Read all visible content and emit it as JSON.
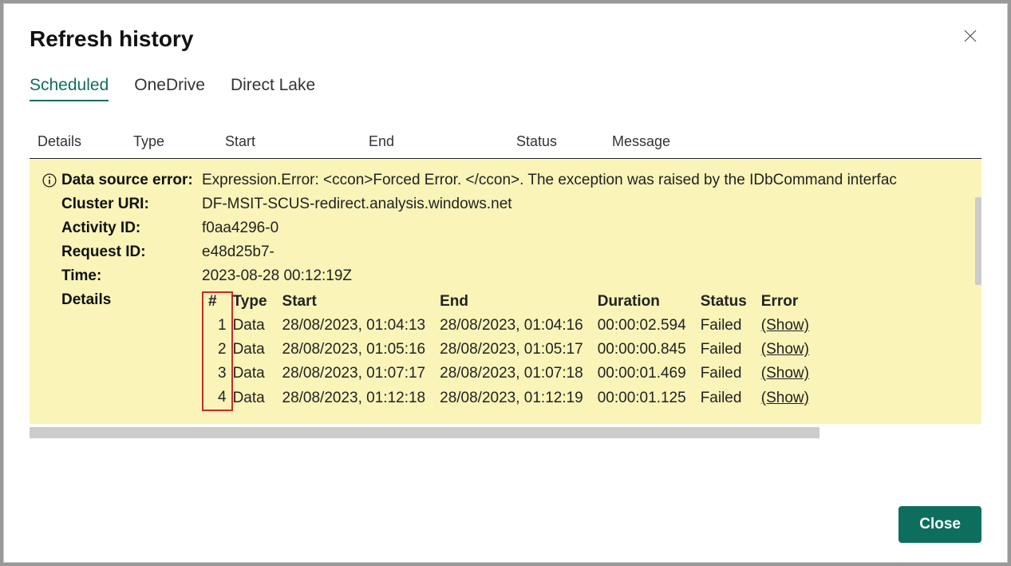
{
  "dialog": {
    "title": "Refresh history",
    "close_btn": "Close"
  },
  "tabs": [
    {
      "label": "Scheduled",
      "active": true
    },
    {
      "label": "OneDrive",
      "active": false
    },
    {
      "label": "Direct Lake",
      "active": false
    }
  ],
  "columns": {
    "details": "Details",
    "type": "Type",
    "start": "Start",
    "end": "End",
    "status": "Status",
    "message": "Message"
  },
  "error": {
    "labels": {
      "data_source_error": "Data source error:",
      "cluster_uri": "Cluster URI:",
      "activity_id": "Activity ID:",
      "request_id": "Request ID:",
      "time": "Time:",
      "details": "Details"
    },
    "values": {
      "data_source_error": "Expression.Error: <ccon>Forced Error. </ccon>. The exception was raised by the IDbCommand interfac",
      "cluster_uri": "DF-MSIT-SCUS-redirect.analysis.windows.net",
      "activity_id": "f0aa4296-0",
      "request_id": "e48d25b7-",
      "time": "2023-08-28 00:12:19Z"
    },
    "details_table": {
      "headers": {
        "num": "#",
        "type": "Type",
        "start": "Start",
        "end": "End",
        "duration": "Duration",
        "status": "Status",
        "error": "Error"
      },
      "show_label": "(Show)",
      "rows": [
        {
          "num": "1",
          "type": "Data",
          "start": "28/08/2023, 01:04:13",
          "end": "28/08/2023, 01:04:16",
          "duration": "00:00:02.594",
          "status": "Failed"
        },
        {
          "num": "2",
          "type": "Data",
          "start": "28/08/2023, 01:05:16",
          "end": "28/08/2023, 01:05:17",
          "duration": "00:00:00.845",
          "status": "Failed"
        },
        {
          "num": "3",
          "type": "Data",
          "start": "28/08/2023, 01:07:17",
          "end": "28/08/2023, 01:07:18",
          "duration": "00:00:01.469",
          "status": "Failed"
        },
        {
          "num": "4",
          "type": "Data",
          "start": "28/08/2023, 01:12:18",
          "end": "28/08/2023, 01:12:19",
          "duration": "00:00:01.125",
          "status": "Failed"
        }
      ]
    }
  }
}
